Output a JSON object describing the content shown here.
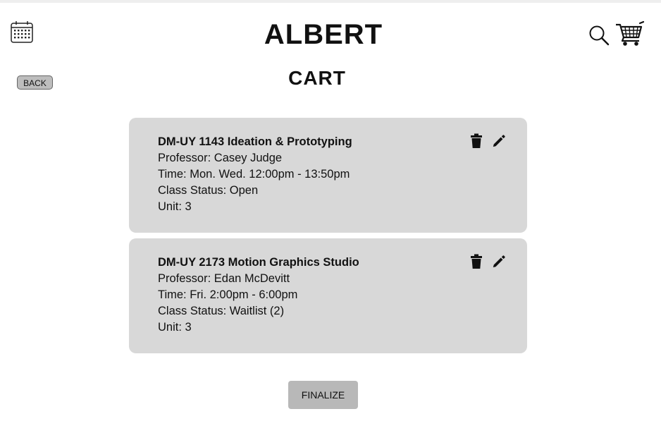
{
  "header": {
    "app_title": "ALBERT",
    "page_title": "CART",
    "back_label": "BACK",
    "icons": {
      "calendar": "calendar-icon",
      "search": "search-icon",
      "cart": "shopping-cart-icon"
    }
  },
  "cart": {
    "items": [
      {
        "title": "DM-UY 1143 Ideation & Prototyping",
        "professor": "Professor: Casey Judge",
        "time": "Time: Mon. Wed. 12:00pm - 13:50pm",
        "status": "Class Status: Open",
        "unit": "Unit: 3"
      },
      {
        "title": "DM-UY 2173 Motion Graphics Studio",
        "professor": "Professor: Edan McDevitt",
        "time": "Time: Fri. 2:00pm - 6:00pm",
        "status": "Class Status: Waitlist (2)",
        "unit": "Unit: 3"
      }
    ],
    "item_actions": [
      "trash-icon",
      "pencil-icon"
    ]
  },
  "footer": {
    "finalize_label": "FINALIZE"
  },
  "colors": {
    "card_background": "#d8d8d8",
    "button_background": "#b8b8b8",
    "text": "#111111"
  }
}
